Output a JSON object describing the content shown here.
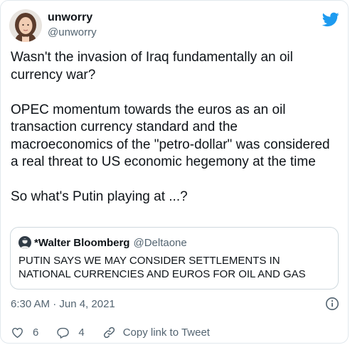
{
  "author": {
    "name": "unworry",
    "handle": "@unworry"
  },
  "tweet": {
    "paragraphs": [
      "Wasn't the invasion of Iraq fundamentally an oil currency war?",
      "OPEC momentum towards the euros as an oil transaction currency standard and the macroeconomics of the \"petro-dollar\" was considered a real threat to US economic hegemony at the time",
      "So what's Putin playing at ...?"
    ]
  },
  "quoted": {
    "name": "*Walter Bloomberg",
    "handle": "@Deltaone",
    "text": "PUTIN SAYS WE MAY CONSIDER SETTLEMENTS IN NATIONAL CURRENCIES AND EUROS FOR OIL AND GAS"
  },
  "meta": {
    "timestamp": "6:30 AM · Jun 4, 2021"
  },
  "actions": {
    "likes": "6",
    "replies": "4",
    "copy_label": "Copy link to Tweet"
  },
  "colors": {
    "twitter_blue": "#1d9bf0",
    "muted": "#536471",
    "border": "#cfd9de"
  }
}
